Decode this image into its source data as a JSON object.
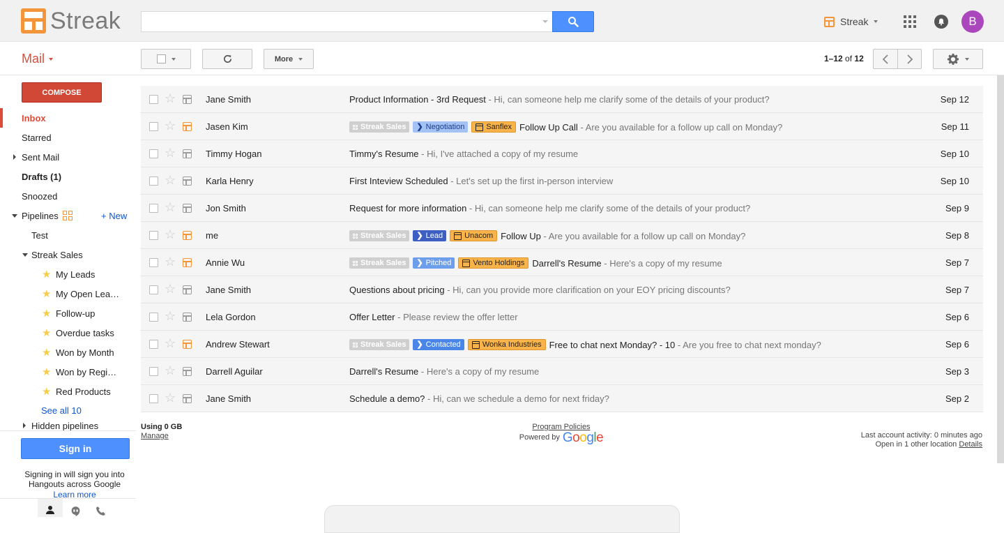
{
  "header": {
    "logo_text": "Streak",
    "search_value": "",
    "streak_menu_label": "Streak",
    "avatar_letter": "B",
    "avatar_color": "#ab47bc",
    "brand_color": "#f4953a"
  },
  "toolbar": {
    "mail_label": "Mail",
    "more_label": "More",
    "pager_range": "1–12",
    "pager_of": "of",
    "pager_total": "12"
  },
  "sidebar": {
    "compose_label": "COMPOSE",
    "items": [
      {
        "label": "Inbox"
      },
      {
        "label": "Starred"
      },
      {
        "label": "Sent Mail"
      },
      {
        "label": "Drafts (1)"
      },
      {
        "label": "Snoozed"
      },
      {
        "label": "Pipelines"
      },
      {
        "label": "Test"
      },
      {
        "label": "Streak Sales"
      }
    ],
    "new_label": "+ New",
    "views": [
      {
        "label": "My Leads"
      },
      {
        "label": "My Open Lea…"
      },
      {
        "label": "Follow-up"
      },
      {
        "label": "Overdue tasks"
      },
      {
        "label": "Won by Month"
      },
      {
        "label": "Won by Regi…"
      },
      {
        "label": "Red Products"
      }
    ],
    "see_all_label": "See all 10",
    "hidden_pipelines_label": "Hidden pipelines",
    "signin_label": "Sign in",
    "signin_text": "Signing in will sign you into Hangouts across Google",
    "learn_more": "Learn more"
  },
  "messages": [
    {
      "sender": "Jane Smith",
      "subject": "Product Information - 3rd Request",
      "snippet": " - Hi, can someone help me clarify some of the details of your product?",
      "date": "Sep 12"
    },
    {
      "sender": "Jasen Kim",
      "pipeline": "Streak Sales",
      "stage": "Negotiation",
      "org": "Sanflex",
      "subject": "Follow Up Call",
      "snippet": " - Are you available for a follow up call on Monday?",
      "date": "Sep 11"
    },
    {
      "sender": "Timmy Hogan",
      "subject": "Timmy's Resume",
      "snippet": " - Hi, I've attached a copy of my resume",
      "date": "Sep 10"
    },
    {
      "sender": "Karla Henry",
      "subject": "First Inteview Scheduled",
      "snippet": " - Let's set up the first in-person interview",
      "date": "Sep 10"
    },
    {
      "sender": "Jon Smith",
      "subject": "Request for more information",
      "snippet": " - Hi, can someone help me clarify some of the details of your product?",
      "date": "Sep 9"
    },
    {
      "sender": "me",
      "pipeline": "Streak Sales",
      "stage": "Lead",
      "org": "Unacom",
      "subject": "Follow Up",
      "snippet": " - Are you available for a follow up call on Monday?",
      "date": "Sep 8"
    },
    {
      "sender": "Annie Wu",
      "pipeline": "Streak Sales",
      "stage": "Pitched",
      "org": "Vento Holdings",
      "subject": "Darrell's Resume",
      "snippet": " - Here's a copy of my resume",
      "date": "Sep 7"
    },
    {
      "sender": "Jane Smith",
      "subject": "Questions about pricing",
      "snippet": " - Hi, can you provide more clarification on your EOY pricing discounts?",
      "date": "Sep 7"
    },
    {
      "sender": "Lela Gordon",
      "subject": "Offer Letter",
      "snippet": " - Please review the offer letter",
      "date": "Sep 6"
    },
    {
      "sender": "Andrew Stewart",
      "pipeline": "Streak Sales",
      "stage": "Contacted",
      "org": "Wonka Industries",
      "subject": "Free to chat next Monday? - 10",
      "snippet": " - Are you free to chat next monday?",
      "date": "Sep 6"
    },
    {
      "sender": "Darrell Aguilar",
      "subject": "Darrell's Resume",
      "snippet": " - Here's a copy of my resume",
      "date": "Sep 3"
    },
    {
      "sender": "Jane Smith",
      "subject": "Schedule a demo?",
      "snippet": " - Hi, can we schedule a demo for next friday?",
      "date": "Sep 2"
    }
  ],
  "stage_colors": {
    "Negotiation": {
      "bg": "#a4c2f4",
      "fg": "#1a3d8f"
    },
    "Lead": {
      "bg": "#3d5fc4",
      "fg": "#ffffff"
    },
    "Pitched": {
      "bg": "#6d9eeb",
      "fg": "#ffffff"
    },
    "Contacted": {
      "bg": "#4a86e8",
      "fg": "#ffffff"
    }
  },
  "footer": {
    "usage": "Using 0 GB",
    "manage": "Manage",
    "policies": "Program Policies",
    "powered_by": "Powered by",
    "google": "Google",
    "last_activity": "Last account activity: 0 minutes ago",
    "open_location": "Open in 1 other location",
    "details": "Details"
  }
}
